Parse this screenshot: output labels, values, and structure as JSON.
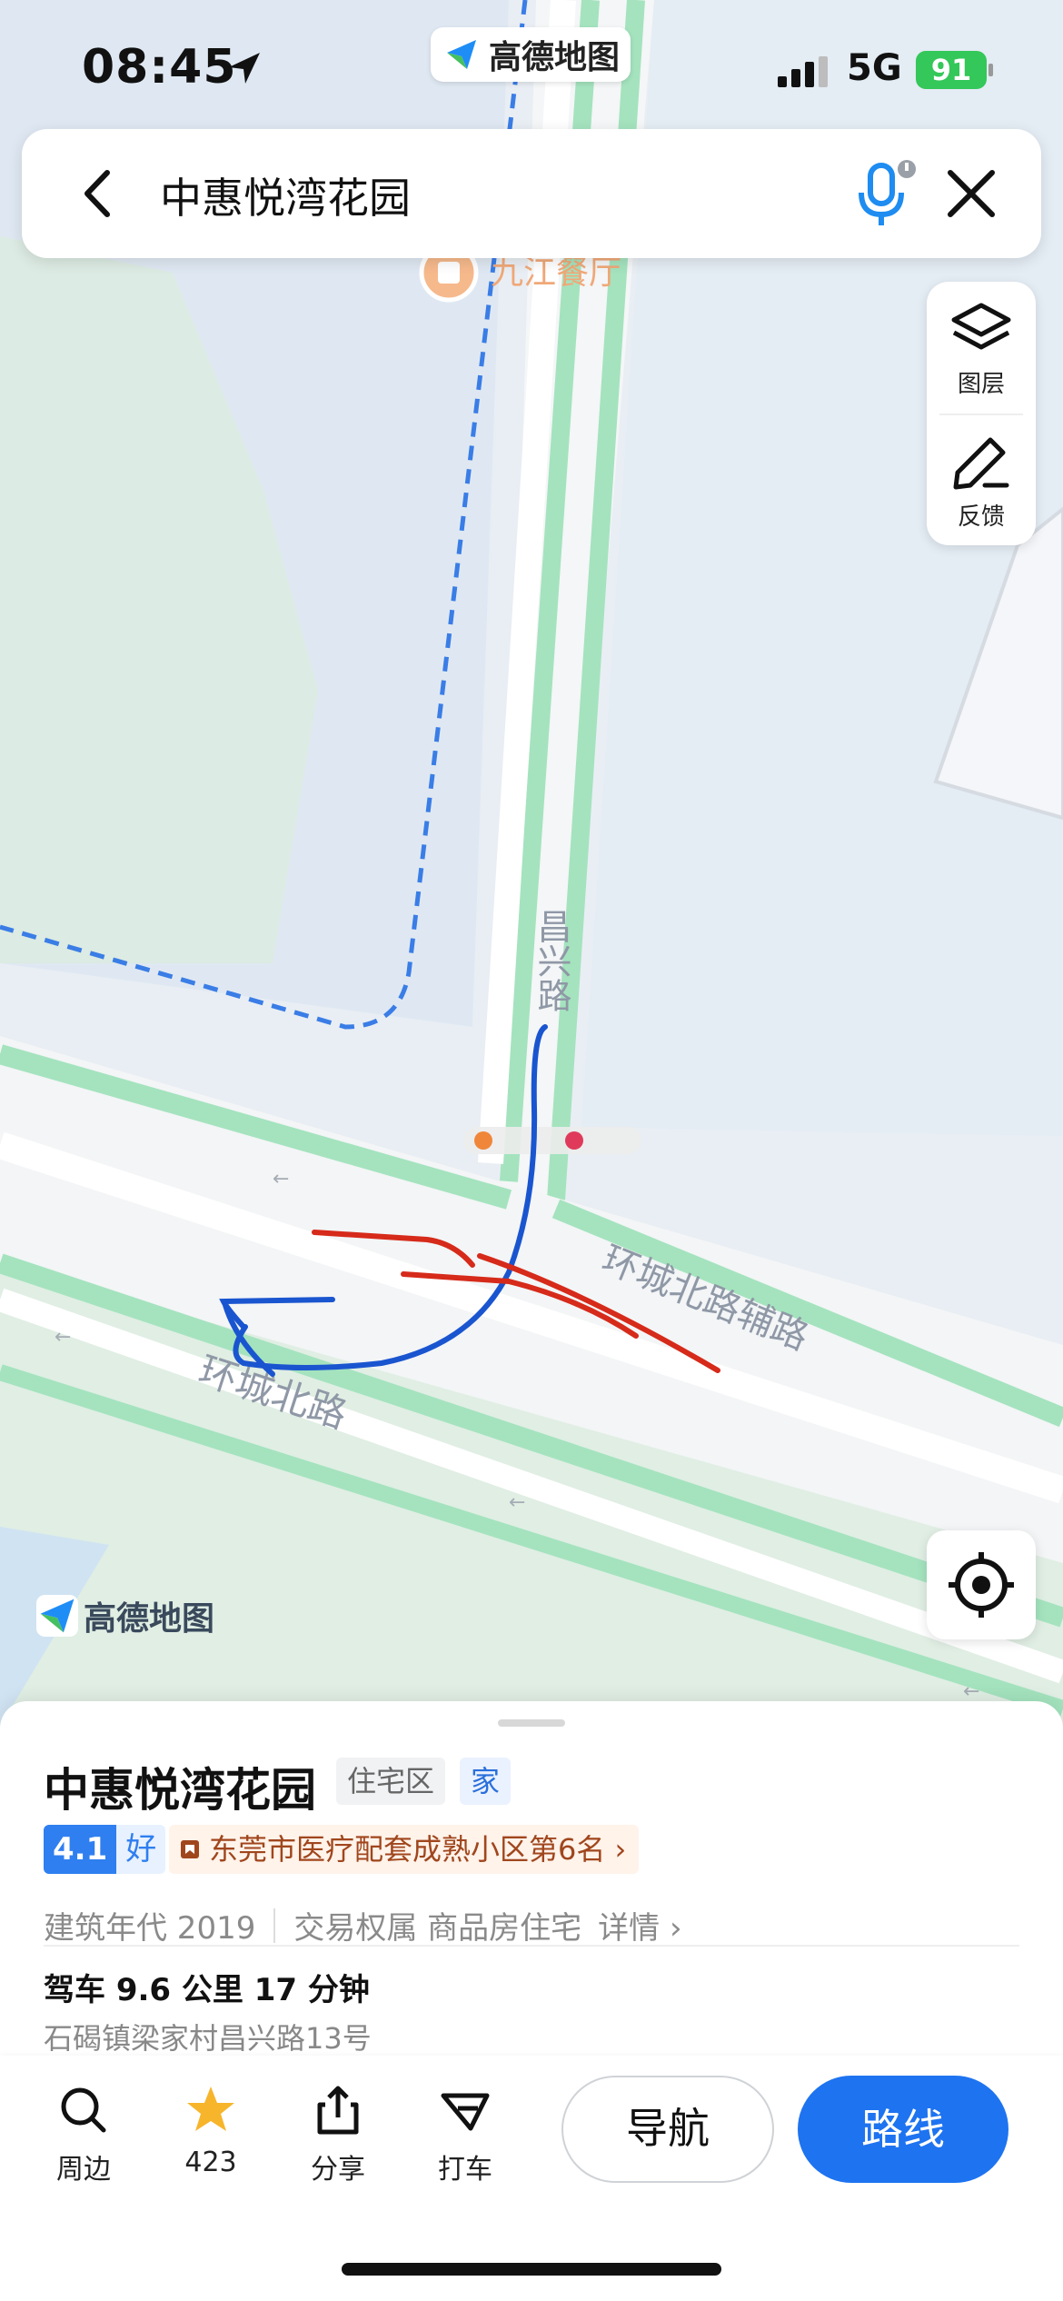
{
  "status_bar": {
    "time": "08:45",
    "app_name": "高德地图",
    "network": "5G",
    "battery": "91"
  },
  "search": {
    "query": "中惠悦湾花园"
  },
  "map": {
    "poi_restaurant": "九江餐厅",
    "road_vertical": "昌兴路",
    "road_main": "环城北路",
    "road_side": "环城北路辅路",
    "watermark": "高德地图",
    "overlay_colors": {
      "blue": "#1a55d0",
      "red": "#d62a1a",
      "road_edge": "#9ee0b9"
    }
  },
  "tools": {
    "layers_label": "图层",
    "feedback_label": "反馈"
  },
  "place": {
    "name": "中惠悦湾花园",
    "tag_type": "住宅区",
    "tag_home": "家",
    "rating_score": "4.1",
    "rating_word": "好",
    "rank_text": "东莞市医疗配套成熟小区第6名 ›",
    "built_year": "建筑年代 2019",
    "ownership": "交易权属 商品房住宅",
    "details": "详情 ›",
    "drive_info": "驾车 9.6 公里 17 分钟",
    "address": "石碣镇梁家村昌兴路13号"
  },
  "actions": {
    "nearby": "周边",
    "favorites": "423",
    "share": "分享",
    "taxi": "打车",
    "navigate": "导航",
    "route": "路线"
  }
}
